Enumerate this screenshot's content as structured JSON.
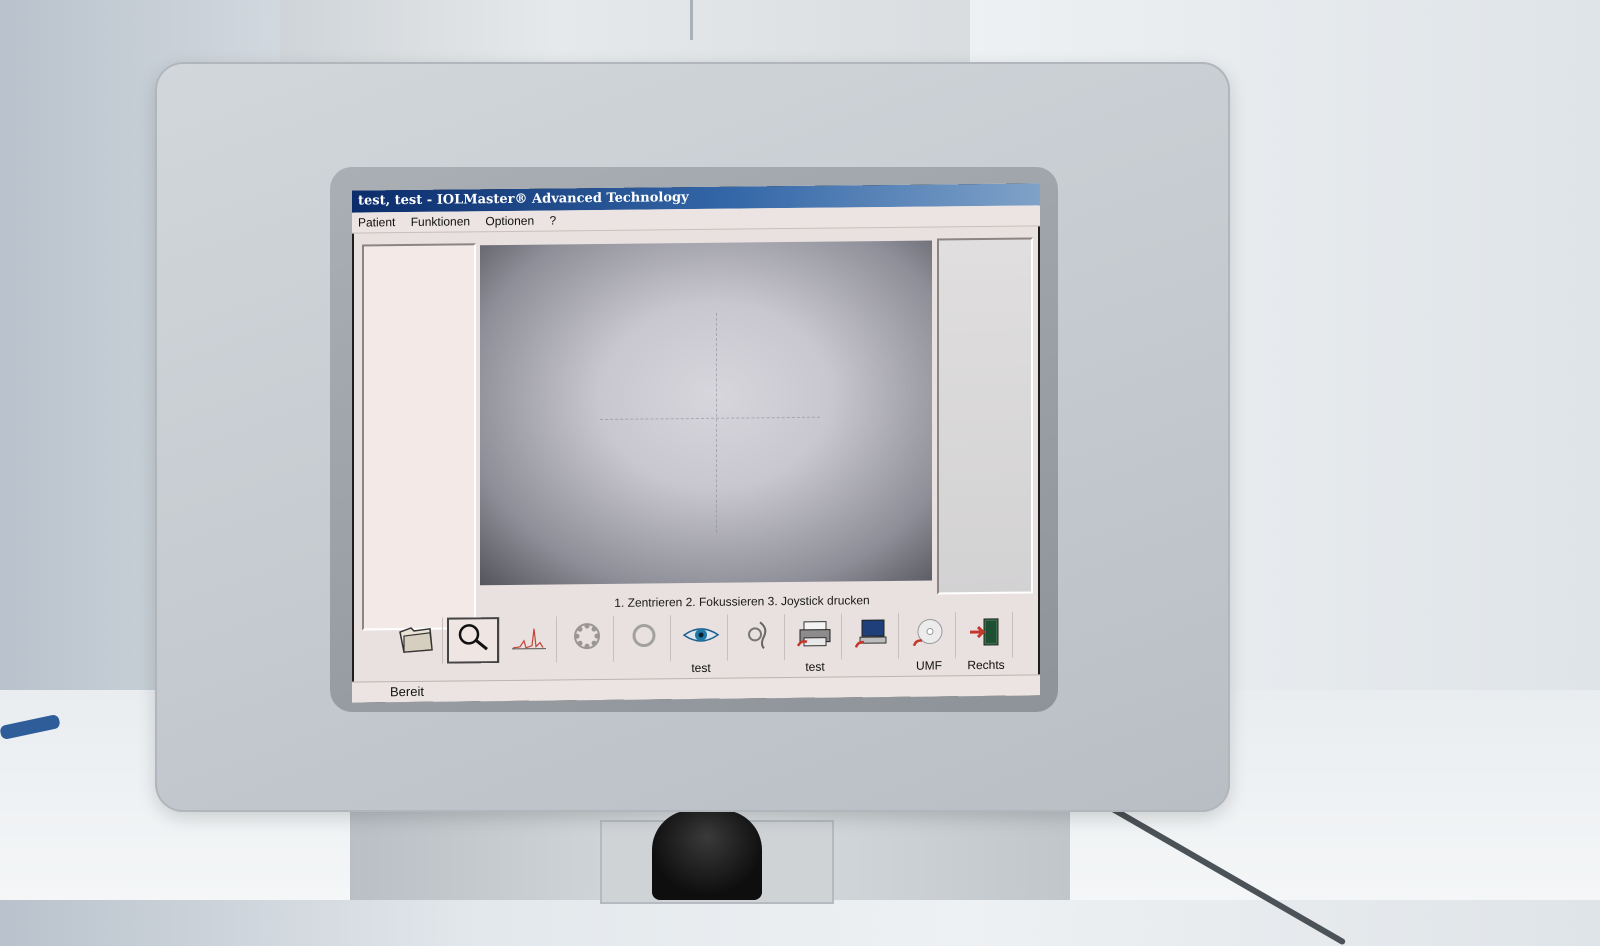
{
  "window": {
    "title": "test, test - IOLMaster® Advanced Technology"
  },
  "menu": {
    "items": [
      "Patient",
      "Funktionen",
      "Optionen",
      "?"
    ]
  },
  "instruction": "1. Zentrieren 2. Fokussieren 3. Joystick drucken",
  "toolbar": {
    "items": [
      {
        "icon": "folder-icon",
        "label": ""
      },
      {
        "icon": "magnifier-icon",
        "label": "",
        "selected": true
      },
      {
        "icon": "graph-icon",
        "label": ""
      },
      {
        "icon": "keratometer-ring-icon",
        "label": ""
      },
      {
        "icon": "circle-icon",
        "label": ""
      },
      {
        "icon": "eye-icon",
        "label": "test"
      },
      {
        "icon": "eye-profile-icon",
        "label": ""
      },
      {
        "icon": "printer-icon",
        "label": "test"
      },
      {
        "icon": "computer-icon",
        "label": ""
      },
      {
        "icon": "disc-icon",
        "label": "UMF"
      },
      {
        "icon": "exit-door-icon",
        "label": "Rechts"
      }
    ]
  },
  "status": {
    "text": "Bereit"
  }
}
